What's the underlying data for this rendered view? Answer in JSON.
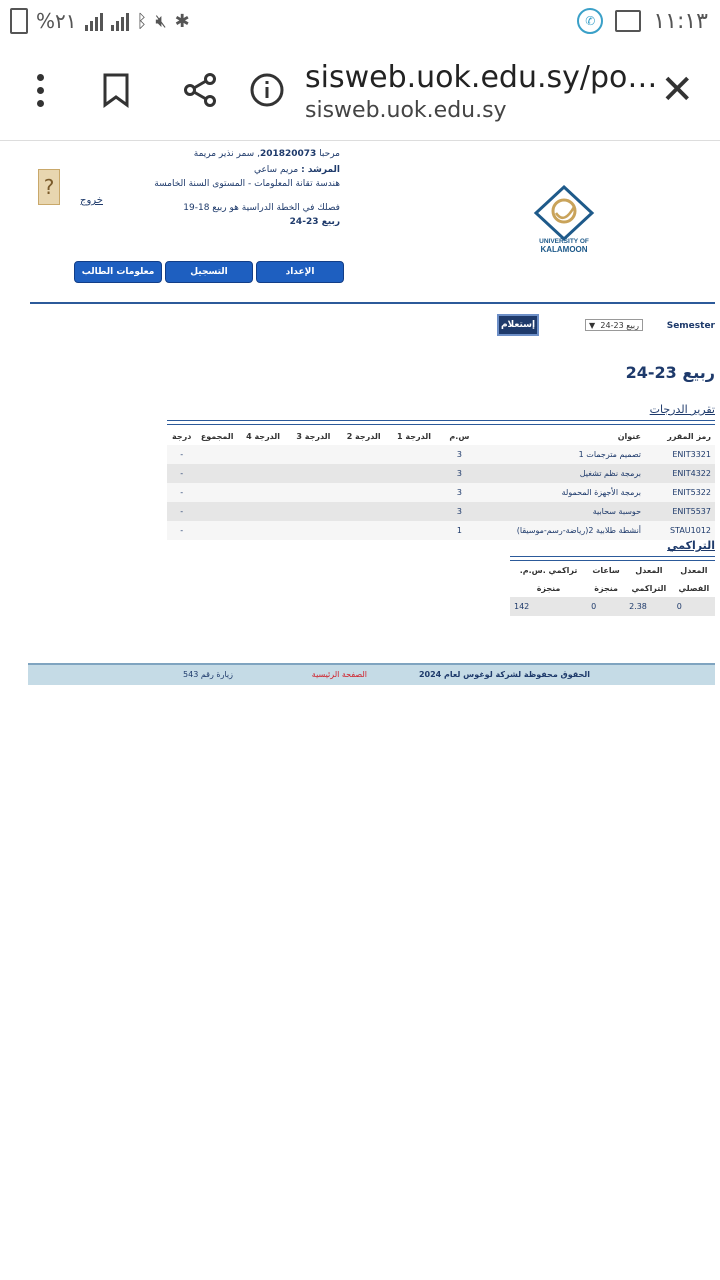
{
  "status_bar": {
    "time": "١١:١٣",
    "battery": "%٢١",
    "icons": [
      "whatsapp-icon",
      "image-icon",
      "bluetooth-icon",
      "mute-icon",
      "nfc-icon",
      "signal-icon",
      "battery-icon"
    ]
  },
  "browser": {
    "url_main": "sisweb.uok.edu.sy/po…",
    "url_domain": "sisweb.uok.edu.sy"
  },
  "student": {
    "welcome": "مرحبا",
    "id": "201820073",
    "name": "سمر نذير مريمة",
    "advisor_label": "المرشد :",
    "advisor": "مريم ساعي",
    "program": "هندسة تقانة المعلومات - المستوى السنة الخامسة",
    "plan_line": "فصلك في الخطة الدراسية هو ربيع 18-19",
    "current_term": "ربيع 23-24",
    "logout": "خروج"
  },
  "logo": {
    "line1": "UNIVERSITY OF",
    "line2": "KALAMOON"
  },
  "tabs": [
    "معلومات الطالب",
    "التسجيل",
    "الإعداد"
  ],
  "semester": {
    "label": "Semester",
    "selected": "ربيع 23-24",
    "query_button": "إستعلام"
  },
  "term_title": "ربيع 23-24",
  "grades": {
    "title": "تقرير الدرجات",
    "headers": [
      "رمز المقرر",
      "عنوان",
      "س.م",
      "الدرجة 1",
      "الدرجة 2",
      "الدرجة 3",
      "الدرجة 4",
      "المجموع",
      "درجة"
    ],
    "rows": [
      {
        "code": "ENIT3321",
        "title": "تصميم مترجمات 1",
        "hours": "3",
        "g1": "",
        "g2": "",
        "g3": "",
        "g4": "",
        "total": "",
        "grade": "-"
      },
      {
        "code": "ENIT4322",
        "title": "برمجة نظم تشغيل",
        "hours": "3",
        "g1": "",
        "g2": "",
        "g3": "",
        "g4": "",
        "total": "",
        "grade": "-"
      },
      {
        "code": "ENIT5322",
        "title": "برمجة الأجهزة المحمولة",
        "hours": "3",
        "g1": "",
        "g2": "",
        "g3": "",
        "g4": "",
        "total": "",
        "grade": "-"
      },
      {
        "code": "ENIT5537",
        "title": "حوسبة سحابية",
        "hours": "3",
        "g1": "",
        "g2": "",
        "g3": "",
        "g4": "",
        "total": "",
        "grade": "-"
      },
      {
        "code": "STAU1012",
        "title": "أنشطة طلابية 2(رياضة-رسم-موسيقا)",
        "hours": "1",
        "g1": "",
        "g2": "",
        "g3": "",
        "g4": "",
        "total": "",
        "grade": "-"
      }
    ]
  },
  "cumulative": {
    "title": "التراكمي",
    "headers_line1": [
      "المعدل",
      "المعدل",
      "ساعات",
      "تراكمي .س.م."
    ],
    "headers_line2": [
      "الفصلي",
      "التراكمي",
      "منجزة",
      "منجزة"
    ],
    "values": [
      "0",
      "2.38",
      "0",
      "142"
    ]
  },
  "footer": {
    "copyright": "الحقوق محفوظة لشركة لوغوس لعام 2024",
    "home": "الصفحة الرئيسية",
    "visits": "زيارة رقم 543"
  },
  "colors": {
    "primary": "#1e3a6b",
    "tab": "#1e5fc0",
    "footer_bg": "#c5dbe6",
    "home_link": "#d0202a"
  }
}
